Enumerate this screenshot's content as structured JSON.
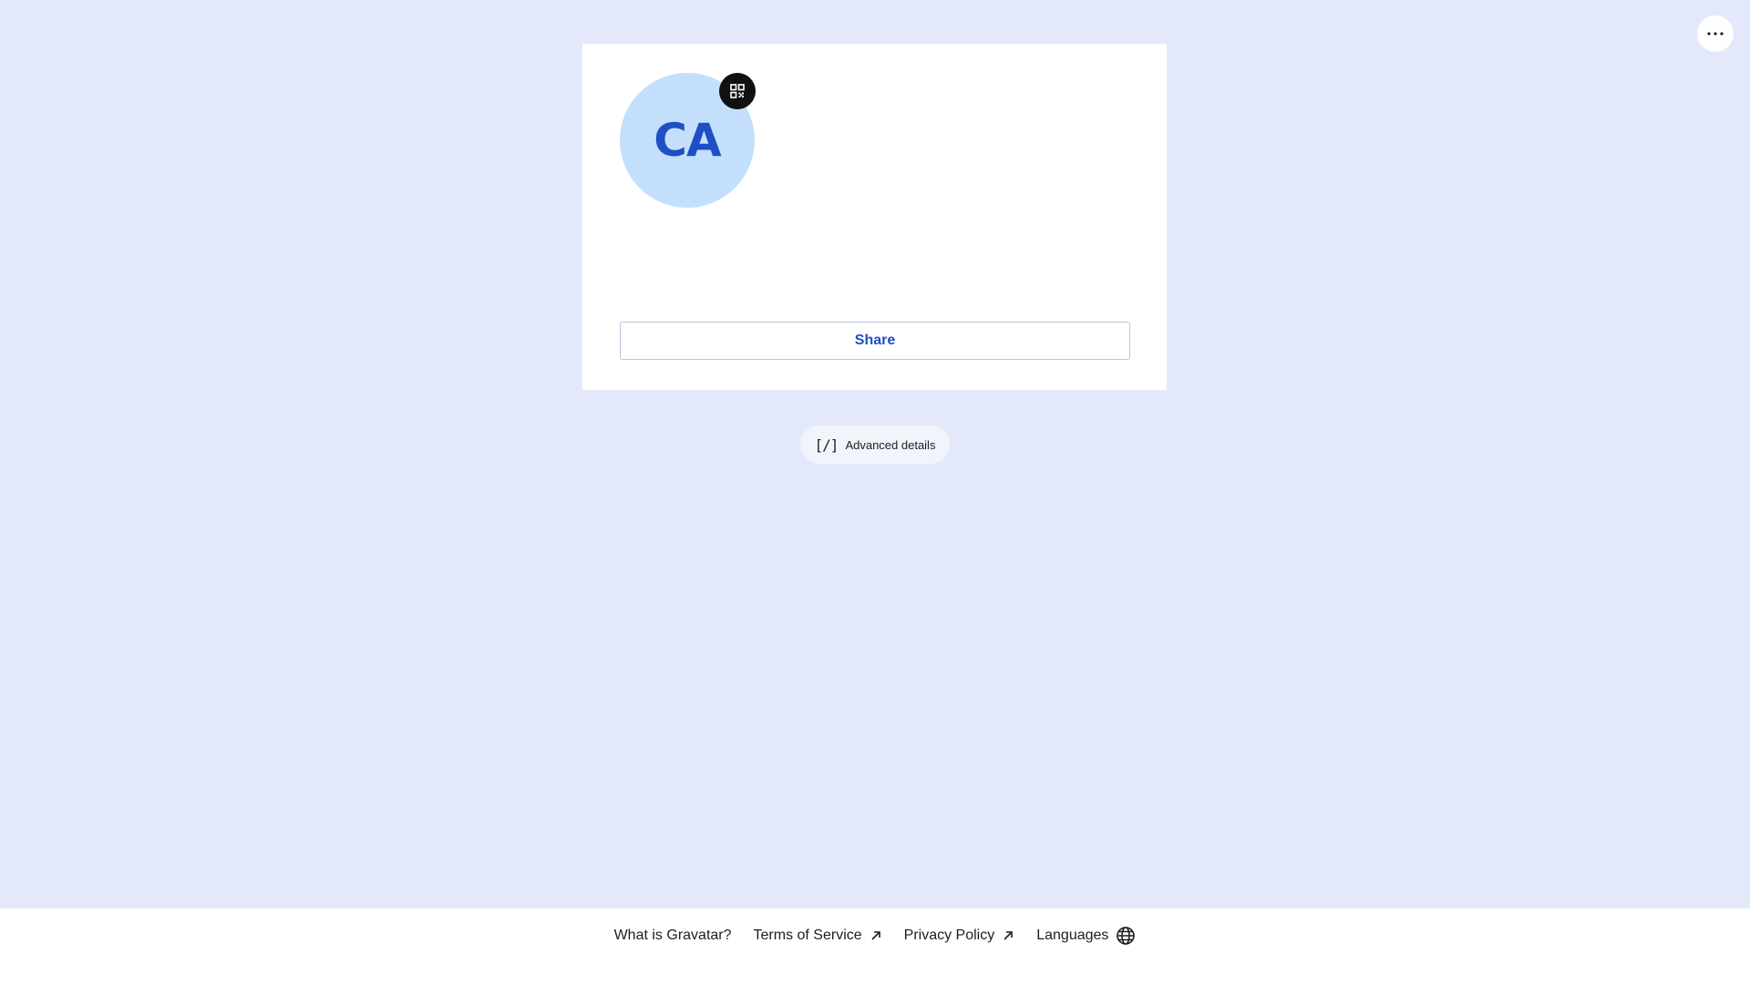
{
  "header": {
    "more_icon": "more-horizontal-icon"
  },
  "profile": {
    "avatar_initials": "CA",
    "avatar_bg_color": "#c4dffb",
    "avatar_text_color": "#1f4fc5",
    "qr_icon": "qr-code-icon",
    "share_label": "Share"
  },
  "advanced": {
    "icon": "code-brackets-icon",
    "icon_text": "[/]",
    "label": "Advanced details"
  },
  "footer": {
    "links": [
      {
        "label": "What is Gravatar?",
        "icon": ""
      },
      {
        "label": "Terms of Service",
        "icon": "arrow-up-right-icon"
      },
      {
        "label": "Privacy Policy",
        "icon": "arrow-up-right-icon"
      },
      {
        "label": "Languages",
        "icon": "globe-icon"
      }
    ]
  },
  "colors": {
    "page_bg": "#e3e9fb",
    "accent": "#1f4fc5",
    "text": "#1e1e1e"
  }
}
